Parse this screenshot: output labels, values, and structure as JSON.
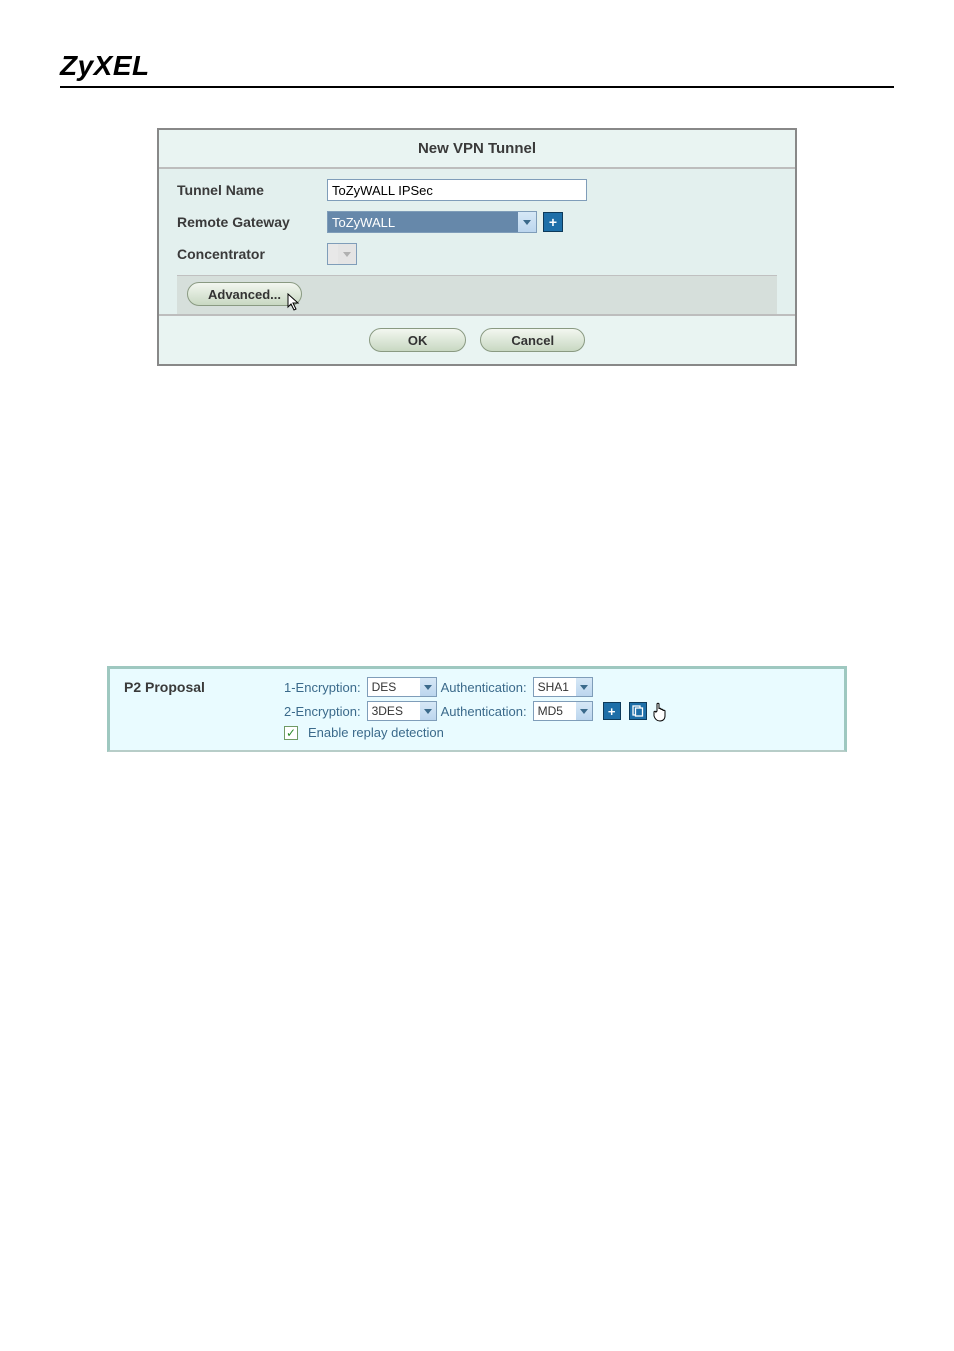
{
  "brand": "ZyXEL",
  "dialog1": {
    "title": "New VPN Tunnel",
    "rows": {
      "tunnel_name_label": "Tunnel Name",
      "tunnel_name_value": "ToZyWALL IPSec",
      "remote_gateway_label": "Remote Gateway",
      "remote_gateway_value": "ToZyWALL",
      "concentrator_label": "Concentrator",
      "concentrator_value": ""
    },
    "buttons": {
      "advanced": "Advanced...",
      "ok": "OK",
      "cancel": "Cancel"
    },
    "icons": {
      "add": "+"
    }
  },
  "panel2": {
    "label": "P2 Proposal",
    "row1_prefix": "1-Encryption:",
    "row1_enc": "DES",
    "row1_auth_label": "Authentication:",
    "row1_auth": "SHA1",
    "row2_prefix": "2-Encryption:",
    "row2_enc": "3DES",
    "row2_auth_label": "Authentication:",
    "row2_auth": "MD5",
    "checkbox_label": "Enable replay detection",
    "checkbox_checked": true,
    "icons": {
      "add": "+",
      "remove": "□"
    }
  }
}
